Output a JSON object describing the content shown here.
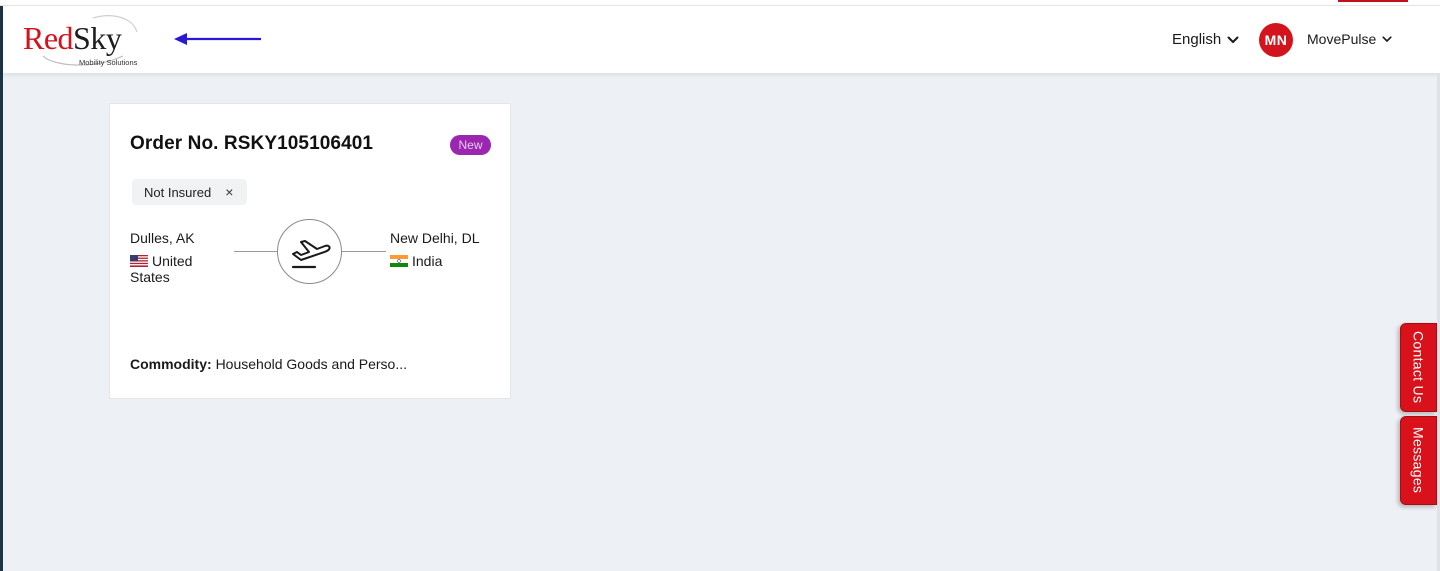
{
  "header": {
    "logo": {
      "brand_red": "Red",
      "brand_dark": "Sky",
      "tagline": "Mobility Solutions"
    },
    "language": {
      "selected": "English"
    },
    "user": {
      "initials": "MN",
      "name": "MovePulse"
    }
  },
  "order_card": {
    "title": "Order No. RSKY105106401",
    "status": "New",
    "insurance_chip": {
      "label": "Not Insured",
      "close": "×"
    },
    "origin": {
      "city": "Dulles, AK",
      "country": "United States"
    },
    "destination": {
      "city": "New Delhi, DL",
      "country": "India"
    },
    "commodity": {
      "label": "Commodity:",
      "value": "Household Goods and Perso..."
    }
  },
  "side_tabs": {
    "contact": "Contact Us",
    "messages": "Messages"
  },
  "colors": {
    "brand_red": "#d3121b",
    "status_purple": "#9b27b0",
    "background": "#edf0f4",
    "arrow_blue": "#2b18d6"
  },
  "icons": {
    "language_dropdown": "chevron-down-icon",
    "user_dropdown": "chevron-down-icon",
    "mode": "plane-departure-icon",
    "annotation": "arrow-left-icon"
  }
}
